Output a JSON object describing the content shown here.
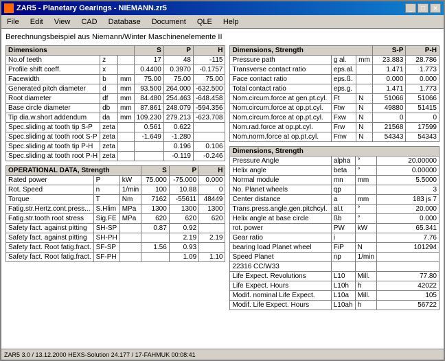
{
  "window": {
    "title": "ZAR5 - Planetary Gearings  -  NIEMANN.zr5",
    "icon": "gear-icon"
  },
  "menu": {
    "items": [
      "File",
      "Edit",
      "View",
      "CAD",
      "Database",
      "Document",
      "QLE",
      "Help"
    ]
  },
  "subtitle": "Berechnungsbeispiel aus Niemann/Winter Maschinenelemente II",
  "left_table1": {
    "header": "Dimensions",
    "columns": [
      "",
      "",
      "",
      "S",
      "P",
      "H"
    ],
    "rows": [
      [
        "No.of teeth",
        "z",
        "",
        "17",
        "48",
        "-115"
      ],
      [
        "Profile shift coeff.",
        "x",
        "",
        "0.4400",
        "0.3970",
        "-0.1757"
      ],
      [
        "Facewidth",
        "b",
        "mm",
        "75.00",
        "75.00",
        "75.00"
      ],
      [
        "Generated pitch diameter",
        "d",
        "mm",
        "93.500",
        "264.000",
        "-632.500"
      ],
      [
        "Root diameter",
        "df",
        "mm",
        "84.480",
        "254.463",
        "-648.458"
      ],
      [
        "Base circle diameter",
        "db",
        "mm",
        "87.861",
        "248.079",
        "-594.356"
      ],
      [
        "Tip dia.w.short addendum",
        "da",
        "mm",
        "109.230",
        "279.213",
        "-623.708"
      ],
      [
        "Spec.sliding at tooth tip S-P",
        "zeta",
        "",
        "0.561",
        "0.622",
        ""
      ],
      [
        "Spec.sliding at tooth root S-P",
        "zeta",
        "",
        "-1.649",
        "-1.280",
        ""
      ],
      [
        "Spec.sliding at tooth tip P-H",
        "zeta",
        "",
        "",
        "0.196",
        "0.106"
      ],
      [
        "Spec.sliding at tooth root P-H",
        "zeta",
        "",
        "",
        "-0.119",
        "-0.246"
      ]
    ]
  },
  "left_table2": {
    "header": "OPERATIONAL DATA, Strength",
    "columns": [
      "",
      "",
      "",
      "S",
      "P",
      "H"
    ],
    "rows": [
      [
        "Rated power",
        "P",
        "kW",
        "75.000",
        "-75.000",
        "0.000"
      ],
      [
        "Rot. Speed",
        "n",
        "1/min",
        "100",
        "10.88",
        "0"
      ],
      [
        "Torque",
        "T",
        "Nm",
        "7162",
        "-55611",
        "48449"
      ],
      [
        "Fatig.str.Hertz.cont.press...",
        "S.Hlim",
        "MPa",
        "1300",
        "1300",
        "1300"
      ],
      [
        "Fatig.str.tooth root stress",
        "Sig.FE",
        "MPa",
        "620",
        "620",
        "620"
      ],
      [
        "Safety fact. against pitting",
        "SH-SP",
        "",
        "0.87",
        "0.92",
        ""
      ],
      [
        "Safety fact. against pitting",
        "SH-PH",
        "",
        "",
        "2.19",
        "2.19"
      ],
      [
        "Safety fact. Root fatig.fract.",
        "SF-SP",
        "",
        "1.56",
        "0.93",
        ""
      ],
      [
        "Safety fact. Root fatig.fract.",
        "SF-PH",
        "",
        "",
        "1.09",
        "1.10"
      ]
    ]
  },
  "right_table1": {
    "header": "Dimensions, Strength",
    "columns": [
      "S-P",
      "P-H"
    ],
    "rows": [
      [
        "Pressure path",
        "g al.",
        "mm",
        "23.883",
        "28.786"
      ],
      [
        "Transverse contact ratio",
        "eps.al.",
        "",
        "1.471",
        "1.773"
      ],
      [
        "Face contact ratio",
        "eps.ß.",
        "",
        "0.000",
        "0.000"
      ],
      [
        "Total contact ratio",
        "eps.g.",
        "",
        "1.471",
        "1.773"
      ],
      [
        "Nom.circum.force at gen.pt.cyl.",
        "Ft",
        "N",
        "51066",
        "51066"
      ],
      [
        "Nom.circum.force at op.pt.cyl.",
        "Ftw",
        "N",
        "49880",
        "51415"
      ],
      [
        "Nom.circum.force at op.pt.cyl.",
        "Fxw",
        "N",
        "0",
        "0"
      ],
      [
        "Nom.rad.force at op.pt.cyl.",
        "Frw",
        "N",
        "21568",
        "17599"
      ],
      [
        "Nom.norm.force at op.pt.cyl.",
        "Fnw",
        "N",
        "54343",
        "54343"
      ]
    ]
  },
  "right_table2": {
    "header": "Dimensions, Strength",
    "rows": [
      [
        "Pressure Angle",
        "alpha",
        "°",
        "20.00000"
      ],
      [
        "Helix angle",
        "beta",
        "°",
        "0.00000"
      ],
      [
        "Normal module",
        "mn",
        "mm",
        "5.5000"
      ],
      [
        "No. Planet wheels",
        "qp",
        "",
        "3"
      ],
      [
        "Center distance",
        "a",
        "mm",
        "183 js 7"
      ],
      [
        "Trans.press.angle.gen.pitchcyl.",
        "al.t",
        "°",
        "20.000"
      ],
      [
        "Helix angle at base circle",
        "ßb",
        "°",
        "0.000"
      ],
      [
        "rot. power",
        "PW",
        "kW",
        "65.341"
      ],
      [
        "Gear ratio",
        "i",
        "",
        "7.76"
      ],
      [
        "bearing load Planet wheel",
        "FiP",
        "N",
        "101294"
      ],
      [
        "Speed Planet",
        "np",
        "1/min",
        ""
      ],
      [
        "22316 CC/W33",
        "",
        "",
        ""
      ],
      [
        "Life Expect. Revolutions",
        "L10",
        "Mill.",
        "77.80"
      ],
      [
        "Life Expect. Hours",
        "L10h",
        "h",
        "42022"
      ],
      [
        "Modif. nominal Life Expect.",
        "L10a",
        "Mill.",
        "105"
      ],
      [
        "Modif. Life Expect. Hours",
        "L10ah",
        "h",
        "56722"
      ]
    ]
  },
  "status_bar": {
    "text": "ZAR5   3.0 / 13.12.2000  HEXS-Solution 24.177 / 17-FAHMUK 00:08:41"
  }
}
